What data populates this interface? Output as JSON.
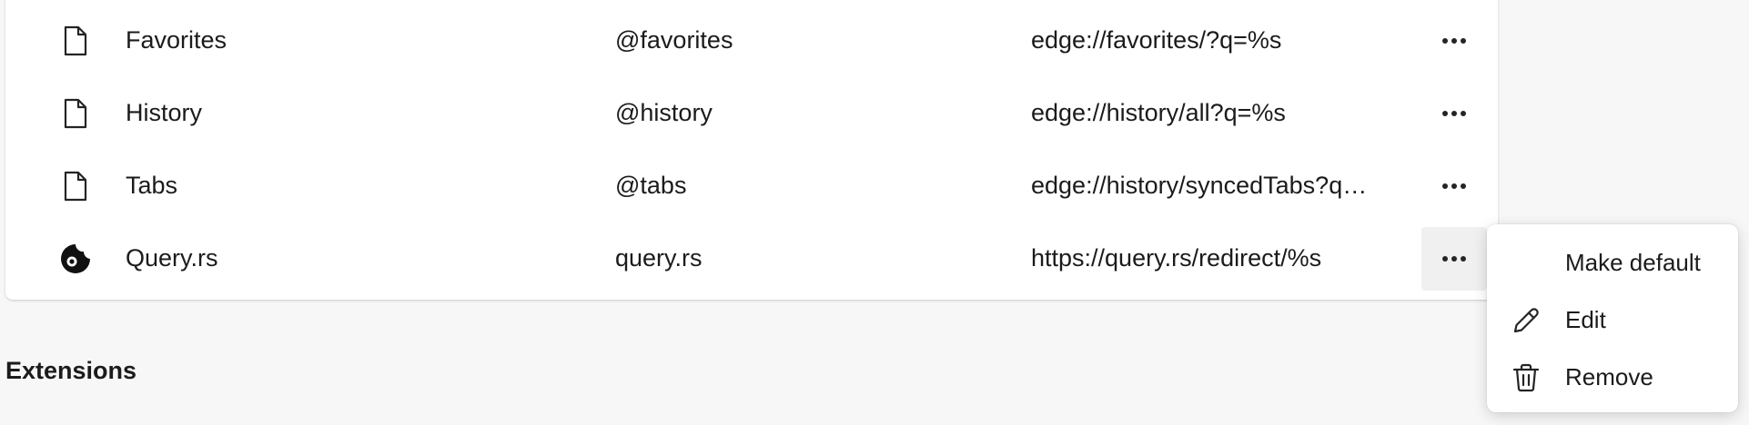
{
  "search_engines": {
    "rows": [
      {
        "name": "Favorites",
        "keyword": "@favorites",
        "url": "edge://favorites/?q=%s",
        "icon": "page-icon"
      },
      {
        "name": "History",
        "keyword": "@history",
        "url": "edge://history/all?q=%s",
        "icon": "page-icon"
      },
      {
        "name": "Tabs",
        "keyword": "@tabs",
        "url": "edge://history/syncedTabs?q…",
        "icon": "page-icon"
      },
      {
        "name": "Query.rs",
        "keyword": "query.rs",
        "url": "https://query.rs/redirect/%s",
        "icon": "query-rs-logo-icon"
      }
    ],
    "more_actions_icon": "more-horizontal-icon"
  },
  "extensions": {
    "title": "Extensions"
  },
  "context_menu": {
    "items": [
      {
        "label": "Make default",
        "icon": ""
      },
      {
        "label": "Edit",
        "icon": "pencil-icon"
      },
      {
        "label": "Remove",
        "icon": "trash-icon"
      }
    ]
  },
  "colors": {
    "background": "#f7f7f7",
    "card": "#ffffff",
    "text": "#1b1b1b",
    "hover": "#f0f0f0"
  }
}
